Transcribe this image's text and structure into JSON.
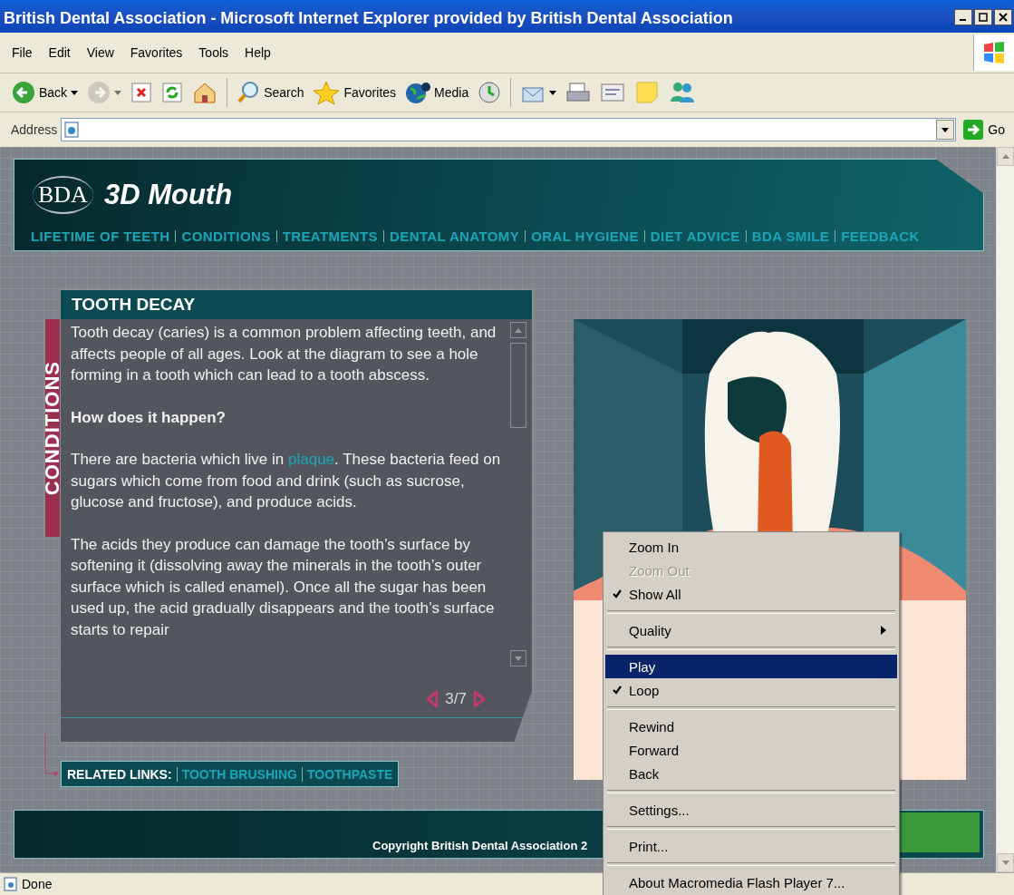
{
  "window": {
    "title": "British Dental Association - Microsoft Internet Explorer provided by British Dental Association"
  },
  "menu_bar": [
    "File",
    "Edit",
    "View",
    "Favorites",
    "Tools",
    "Help"
  ],
  "toolbar": [
    {
      "kind": "button",
      "label": "Back",
      "dropdown": true,
      "disabled": false
    },
    {
      "kind": "button",
      "dropdown": true,
      "disabled": true
    },
    {
      "kind": "button",
      "dropdown": false,
      "disabled": false
    },
    {
      "kind": "button",
      "dropdown": false,
      "disabled": false
    },
    {
      "kind": "button",
      "dropdown": false,
      "disabled": false
    },
    {
      "kind": "separator"
    },
    {
      "kind": "button",
      "label": "Search",
      "dropdown": false,
      "disabled": false
    },
    {
      "kind": "button",
      "label": "Favorites",
      "dropdown": false,
      "disabled": false
    },
    {
      "kind": "button",
      "label": "Media",
      "dropdown": false,
      "disabled": false
    },
    {
      "kind": "button",
      "dropdown": false,
      "disabled": false
    },
    {
      "kind": "separator"
    },
    {
      "kind": "button",
      "dropdown": true,
      "disabled": false
    },
    {
      "kind": "button",
      "dropdown": false,
      "disabled": false
    },
    {
      "kind": "button",
      "dropdown": false,
      "disabled": false
    },
    {
      "kind": "button",
      "dropdown": false,
      "disabled": false
    },
    {
      "kind": "button",
      "dropdown": false,
      "disabled": false
    }
  ],
  "address_bar": {
    "label": "Address",
    "go": "Go"
  },
  "site": {
    "logo": "BDA",
    "title": "3D Mouth",
    "nav": [
      "LIFETIME OF TEETH",
      "CONDITIONS",
      "TREATMENTS",
      "DENTAL ANATOMY",
      "ORAL HYGIENE",
      "DIET ADVICE",
      "BDA SMILE",
      "FEEDBACK"
    ],
    "section_tab": "CONDITIONS",
    "panel": {
      "title": "TOOTH DECAY",
      "paragraphs": [
        {
          "kind": "text",
          "text": "Tooth decay (caries) is a common problem affecting teeth, and affects people of all ages. Look at the diagram to see a hole forming in a tooth which can lead to a tooth abscess."
        },
        {
          "kind": "heading",
          "text": "How does it happen?"
        },
        {
          "kind": "text",
          "text": "There are bacteria which live in ",
          "link": "plaque",
          "after": ". These bacteria feed on sugars which come from food and drink (such as sucrose, glucose and fructose), and produce acids."
        },
        {
          "kind": "text",
          "text": "The acids they produce can damage the tooth’s surface by softening it (dissolving away the minerals in the tooth’s outer surface which is called enamel). Once all the sugar has been used up, the acid gradually disappears and the tooth’s surface starts to repair"
        }
      ],
      "page": "3/7"
    },
    "related_links": {
      "label": "RELATED LINKS:",
      "links": [
        "TOOTH BRUSHING",
        "TOOTHPASTE"
      ]
    },
    "footer": {
      "copyright": "Copyright British Dental Association 2"
    }
  },
  "context_menu": [
    {
      "kind": "item",
      "label": "Zoom In",
      "checked": false,
      "disabled": false,
      "selected": false,
      "submenu": false
    },
    {
      "kind": "item",
      "label": "Zoom Out",
      "checked": false,
      "disabled": true,
      "selected": false,
      "submenu": false
    },
    {
      "kind": "item",
      "label": "Show All",
      "checked": true,
      "disabled": false,
      "selected": false,
      "submenu": false
    },
    {
      "kind": "separator"
    },
    {
      "kind": "item",
      "label": "Quality",
      "checked": false,
      "disabled": false,
      "selected": false,
      "submenu": true
    },
    {
      "kind": "separator"
    },
    {
      "kind": "item",
      "label": "Play",
      "checked": false,
      "disabled": false,
      "selected": true,
      "submenu": false
    },
    {
      "kind": "item",
      "label": "Loop",
      "checked": true,
      "disabled": false,
      "selected": false,
      "submenu": false
    },
    {
      "kind": "separator"
    },
    {
      "kind": "item",
      "label": "Rewind",
      "checked": false,
      "disabled": false,
      "selected": false,
      "submenu": false
    },
    {
      "kind": "item",
      "label": "Forward",
      "checked": false,
      "disabled": false,
      "selected": false,
      "submenu": false
    },
    {
      "kind": "item",
      "label": "Back",
      "checked": false,
      "disabled": false,
      "selected": false,
      "submenu": false
    },
    {
      "kind": "separator"
    },
    {
      "kind": "item",
      "label": "Settings...",
      "checked": false,
      "disabled": false,
      "selected": false,
      "submenu": false
    },
    {
      "kind": "separator"
    },
    {
      "kind": "item",
      "label": "Print...",
      "checked": false,
      "disabled": false,
      "selected": false,
      "submenu": false
    },
    {
      "kind": "separator"
    },
    {
      "kind": "item",
      "label": "About Macromedia Flash Player 7...",
      "checked": false,
      "disabled": false,
      "selected": false,
      "submenu": false
    }
  ],
  "status_bar": {
    "text": "Done"
  }
}
